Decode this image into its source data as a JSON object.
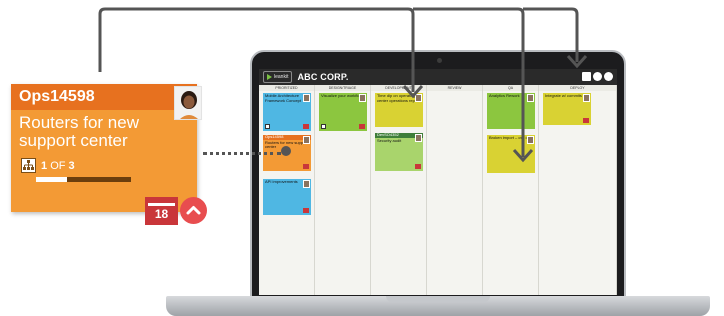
{
  "app": {
    "logo_text": "leankit",
    "org_title": "ABC CORP."
  },
  "lanes": [
    "PRIORITIZED",
    "DESIGN/TRIAGE",
    "DEVELOPMENT",
    "REVIEW",
    "QA",
    "DEPLOY"
  ],
  "cards": {
    "prioritized": [
      {
        "title": "Mobile Architecture Framework Concept",
        "color": "blue"
      },
      {
        "id": "Ops14598",
        "title": "Routers for new support center",
        "color": "orange"
      },
      {
        "title": "API improvements",
        "color": "blue"
      }
    ],
    "design": [
      {
        "title": "Visualize your workflow",
        "color": "green"
      }
    ],
    "development": [
      {
        "title": "Time dip on operating center operations report",
        "color": "yellow"
      },
      {
        "id": "DevSO4352",
        "title": "Security audit",
        "color": "green"
      }
    ],
    "qa": [
      {
        "title": "Analytics Rework",
        "color": "green"
      },
      {
        "title": "Broken import – csv only",
        "color": "yellow"
      }
    ],
    "deploy": [
      {
        "title": "Integrate w/ commits",
        "color": "yellow"
      }
    ]
  },
  "featured_card": {
    "id": "Ops14598",
    "title": "Routers for new support center",
    "progress_current": "1",
    "progress_of": "OF",
    "progress_total": "3",
    "progress_fraction": 0.33,
    "due_day": "18",
    "avatar_icon": "person-avatar-icon",
    "colors": {
      "header": "#e7711f",
      "body": "#f39a35",
      "alert": "#c9363a"
    }
  }
}
